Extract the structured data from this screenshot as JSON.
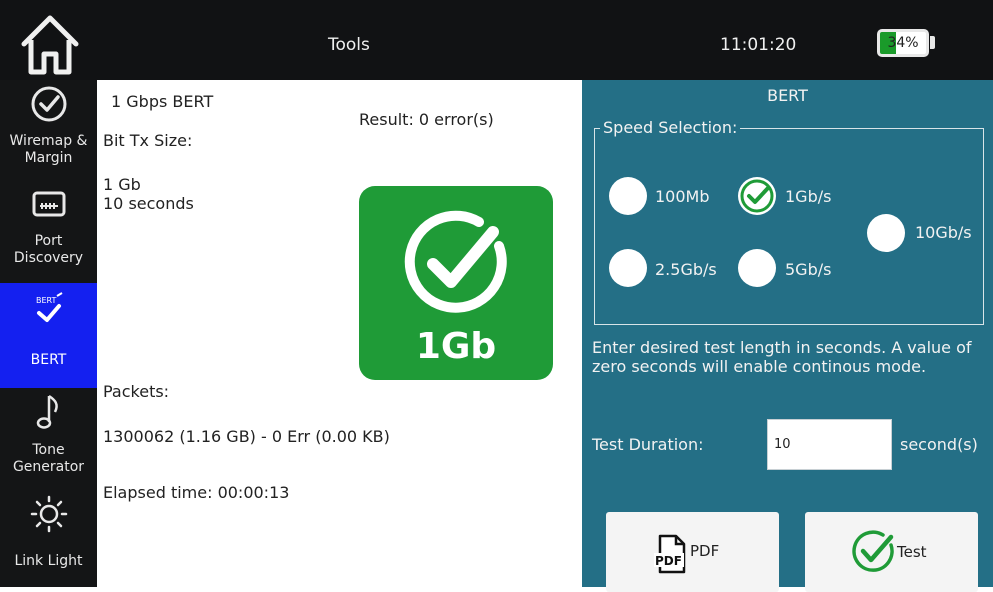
{
  "header": {
    "title": "Tools",
    "time": "11:01:20",
    "battery_percent": "34%",
    "battery_level": 0.34,
    "battery_color": "#1a9a2a"
  },
  "sidebar": {
    "items": [
      {
        "label": "Wiremap & Margin",
        "label_lines": [
          "Wiremap &",
          "Margin"
        ],
        "icon": "check-circle-icon"
      },
      {
        "label": "Port Discovery",
        "label_lines": [
          "Port",
          "Discovery"
        ],
        "icon": "ethernet-port-icon"
      },
      {
        "label": "BERT",
        "label_lines": [
          "BERT"
        ],
        "icon": "bert-icon",
        "active": true
      },
      {
        "label": "Tone Generator",
        "label_lines": [
          "Tone",
          "Generator"
        ],
        "icon": "music-note-icon"
      },
      {
        "label": "Link Light",
        "label_lines": [
          "Link Light"
        ],
        "icon": "sun-icon"
      }
    ]
  },
  "main": {
    "test_name": "1 Gbps BERT",
    "result": "Result: 0 error(s)",
    "bit_tx_label": "Bit Tx Size:",
    "size": "1 Gb",
    "duration": "10 seconds",
    "badge_label": "1Gb",
    "badge_color": "#1f9b37",
    "packets_label": "Packets:",
    "packets_value": "1300062 (1.16 GB) - 0 Err (0.00 KB)",
    "elapsed": "Elapsed time: 00:00:13"
  },
  "panel": {
    "title": "BERT",
    "speed_legend": "Speed Selection:",
    "speeds": [
      {
        "label": "100Mb",
        "checked": false
      },
      {
        "label": "1Gb/s",
        "checked": true
      },
      {
        "label": "10Gb/s",
        "checked": false
      },
      {
        "label": "2.5Gb/s",
        "checked": false
      },
      {
        "label": "5Gb/s",
        "checked": false
      }
    ],
    "description": "Enter desired test length in seconds. A value of zero seconds will enable continous mode.",
    "duration_label": "Test Duration:",
    "duration_value": "10",
    "duration_unit": "second(s)",
    "pdf_button": "PDF",
    "pdf_icon_text": "PDF",
    "test_button": "Test",
    "background_color": "#246f86"
  }
}
